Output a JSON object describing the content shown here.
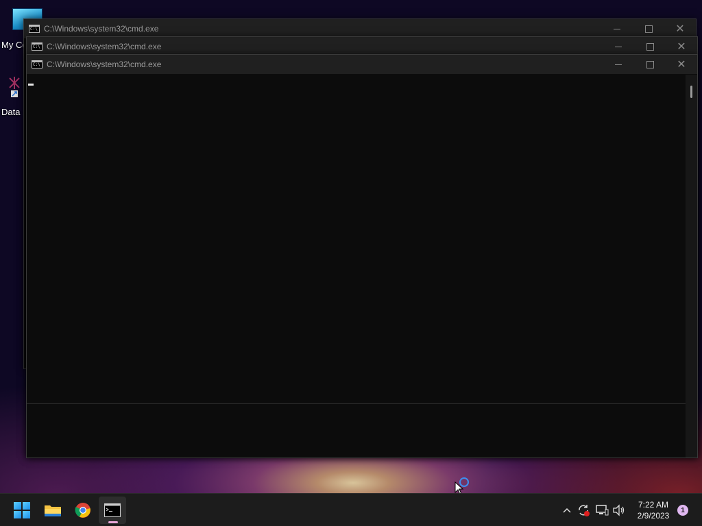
{
  "desktop": {
    "icons": [
      {
        "label": "My Co"
      },
      {
        "label": "Data"
      }
    ]
  },
  "windows": [
    {
      "title": "C:\\Windows\\system32\\cmd.exe"
    },
    {
      "title": "C:\\Windows\\system32\\cmd.exe"
    },
    {
      "title": "C:\\Windows\\system32\\cmd.exe"
    }
  ],
  "taskbar": {
    "apps": [
      {
        "icon": "windows-start-icon"
      },
      {
        "icon": "file-explorer-icon"
      },
      {
        "icon": "chrome-icon"
      },
      {
        "icon": "command-prompt-icon"
      }
    ],
    "tray": {
      "time": "7:22 AM",
      "date": "2/9/2023",
      "notification_count": "1"
    }
  },
  "colors": {
    "console_bg": "#0c0c0c",
    "titlebar_bg": "#202020",
    "taskbar_bg": "#1c1c1c",
    "accent": "#e8a6d8"
  }
}
